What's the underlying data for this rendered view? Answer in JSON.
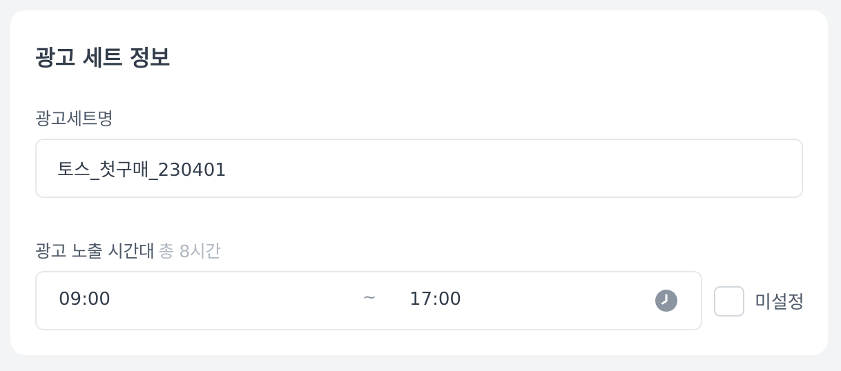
{
  "card": {
    "title": "광고 세트 정보"
  },
  "adset_name": {
    "label": "광고세트명",
    "value": "토스_첫구매_230401"
  },
  "exposure_time": {
    "label": "광고 노출 시간대",
    "total": "총 8시간",
    "start": "09:00",
    "separator": "~",
    "end": "17:00",
    "icon": "clock-icon",
    "unset_label": "미설정",
    "unset_checked": false
  },
  "colors": {
    "background": "#f2f4f6",
    "card": "#ffffff",
    "title_text": "#333d4b",
    "label_text": "#4e5968",
    "muted_text": "#b0b8c1",
    "border": "#e5e8eb",
    "icon": "#8b95a1"
  }
}
